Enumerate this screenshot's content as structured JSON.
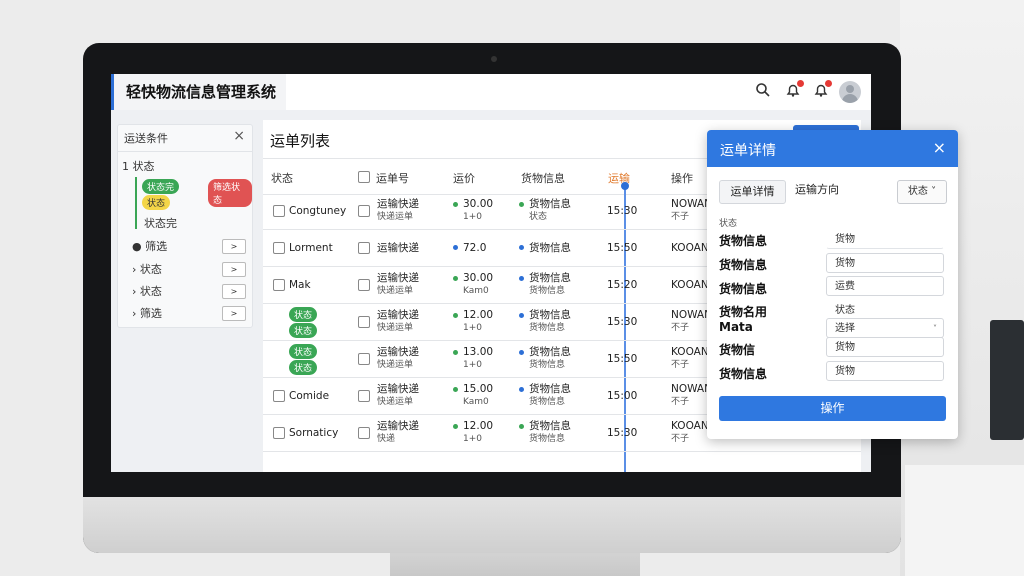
{
  "header": {
    "app_title": "轻快物流信息管理系统",
    "icons": [
      "search-icon",
      "bell-icon",
      "bell-icon",
      "avatar"
    ]
  },
  "filter": {
    "title": "运送条件",
    "status_label": "1 状态",
    "badges": [
      "状态完",
      "状态",
      "筛选状态"
    ],
    "static_item": "状态完",
    "rows": [
      {
        "label": "筛选",
        "btn": ">"
      },
      {
        "label": "状态",
        "btn": ">"
      },
      {
        "label": "状态",
        "btn": ">"
      },
      {
        "label": "筛选",
        "btn": ">"
      }
    ]
  },
  "content": {
    "title": "运单列表",
    "columns": [
      "状态",
      "运单号",
      "运价",
      "货物信息",
      "运输",
      "操作"
    ],
    "rows": [
      {
        "name": "Congtuney",
        "waybill": "运输快递",
        "waybill_sub": "快递运单",
        "price": "30.00",
        "price_sub": "1+0",
        "goods": "货物信息",
        "goods_sub": "状态",
        "time": "15:30",
        "code": "NOWAN",
        "code_sub": "不子"
      },
      {
        "name": "Lorment",
        "waybill": "运输快递",
        "waybill_sub": "",
        "price": "72.0",
        "price_sub": "",
        "goods": "货物信息",
        "goods_sub": "",
        "time": "15:50",
        "code": "KOOAN",
        "code_sub": ""
      },
      {
        "name": "Mak",
        "waybill": "运输快递",
        "waybill_sub": "快递运单",
        "price": "30.00",
        "price_sub": "Kam0",
        "goods": "货物信息",
        "goods_sub": "货物信息",
        "time": "15:20",
        "code": "KOOAN",
        "code_sub": ""
      },
      {
        "badge1": "状态",
        "badge2": "状态",
        "waybill": "运输快递",
        "waybill_sub": "快递运单",
        "price": "12.00",
        "price_sub": "1+0",
        "goods": "货物信息",
        "goods_sub": "货物信息",
        "time": "15:30",
        "code": "NOWAN",
        "code_sub": "不子"
      },
      {
        "badge1": "状态",
        "badge2": "状态",
        "waybill": "运输快递",
        "waybill_sub": "快递运单",
        "price": "13.00",
        "price_sub": "1+0",
        "goods": "货物信息",
        "goods_sub": "货物信息",
        "time": "15:50",
        "code": "KOOAN",
        "code_sub": "不子"
      },
      {
        "name": "Comide",
        "waybill": "运输快递",
        "waybill_sub": "快递运单",
        "price": "15.00",
        "price_sub": "Kam0",
        "goods": "货物信息",
        "goods_sub": "货物信息",
        "time": "15:00",
        "code": "NOWAN",
        "code_sub": "不子"
      },
      {
        "name": "Sornaticy",
        "waybill": "运输快递",
        "waybill_sub": "快递",
        "price": "12.00",
        "price_sub": "1+0",
        "goods": "货物信息",
        "goods_sub": "货物信息",
        "time": "15:30",
        "code": "KOOAN",
        "code_sub": "不子"
      }
    ]
  },
  "details": {
    "title": "运单详情",
    "tabs": [
      "运单详情",
      "运输方向"
    ],
    "select_value": "状态",
    "section": "状态",
    "fields": [
      {
        "label": "货物信息",
        "value": "货物"
      },
      {
        "label": "货物信息",
        "value": "货物"
      },
      {
        "label": "货物信息",
        "value": "运费"
      },
      {
        "label": "货物名用",
        "value": "状态"
      },
      {
        "label": "Mata",
        "value": "选择"
      },
      {
        "label": "货物信",
        "value": "货物"
      },
      {
        "label": "货物信息",
        "value": "货物"
      }
    ],
    "action_label": "操作"
  },
  "colors": {
    "accent": "#2f78e0",
    "green": "#3aa655",
    "red": "#e05353",
    "yellow": "#f3d548"
  }
}
